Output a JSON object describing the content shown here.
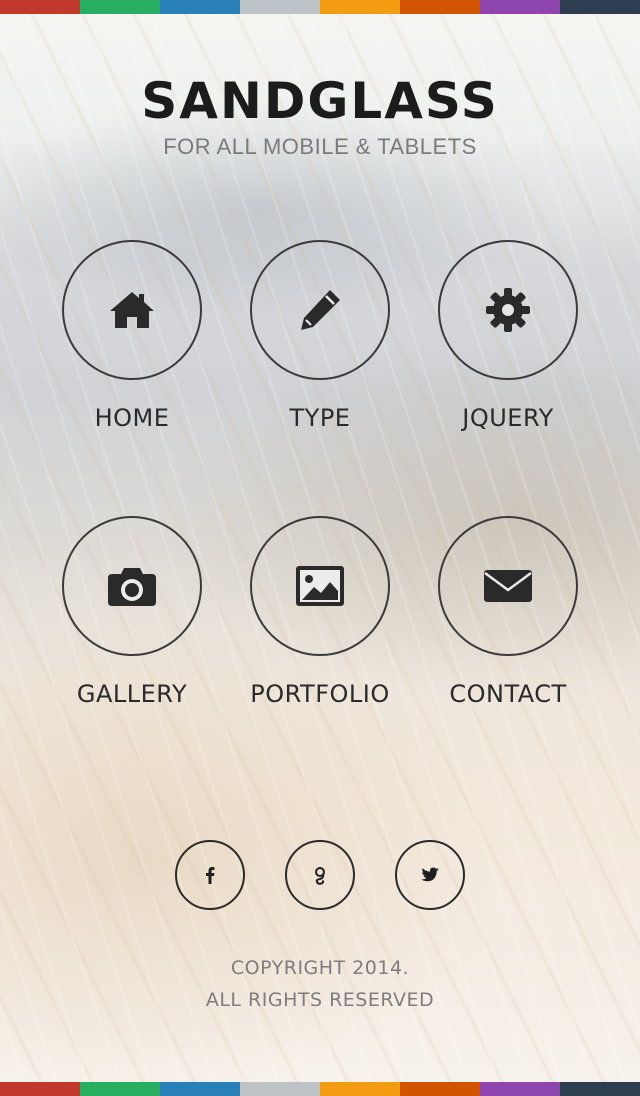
{
  "colors": {
    "bar": [
      "#c0392b",
      "#27ae60",
      "#2980b9",
      "#bdc3c7",
      "#f39c12",
      "#d35400",
      "#8e44ad",
      "#2c3e50"
    ]
  },
  "header": {
    "title": "SANDGLASS",
    "subtitle": "FOR ALL MOBILE & TABLETS"
  },
  "nav": {
    "items": [
      {
        "label": "HOME",
        "icon": "home-icon"
      },
      {
        "label": "TYPE",
        "icon": "pencil-icon"
      },
      {
        "label": "JQUERY",
        "icon": "gear-icon"
      },
      {
        "label": "GALLERY",
        "icon": "camera-icon"
      },
      {
        "label": "PORTFOLIO",
        "icon": "image-icon"
      },
      {
        "label": "CONTACT",
        "icon": "envelope-icon"
      }
    ]
  },
  "social": {
    "items": [
      {
        "icon": "facebook-icon"
      },
      {
        "icon": "google-icon"
      },
      {
        "icon": "twitter-icon"
      }
    ]
  },
  "footer": {
    "line1": "COPYRIGHT 2014.",
    "line2": "ALL RIGHTS RESERVED"
  }
}
